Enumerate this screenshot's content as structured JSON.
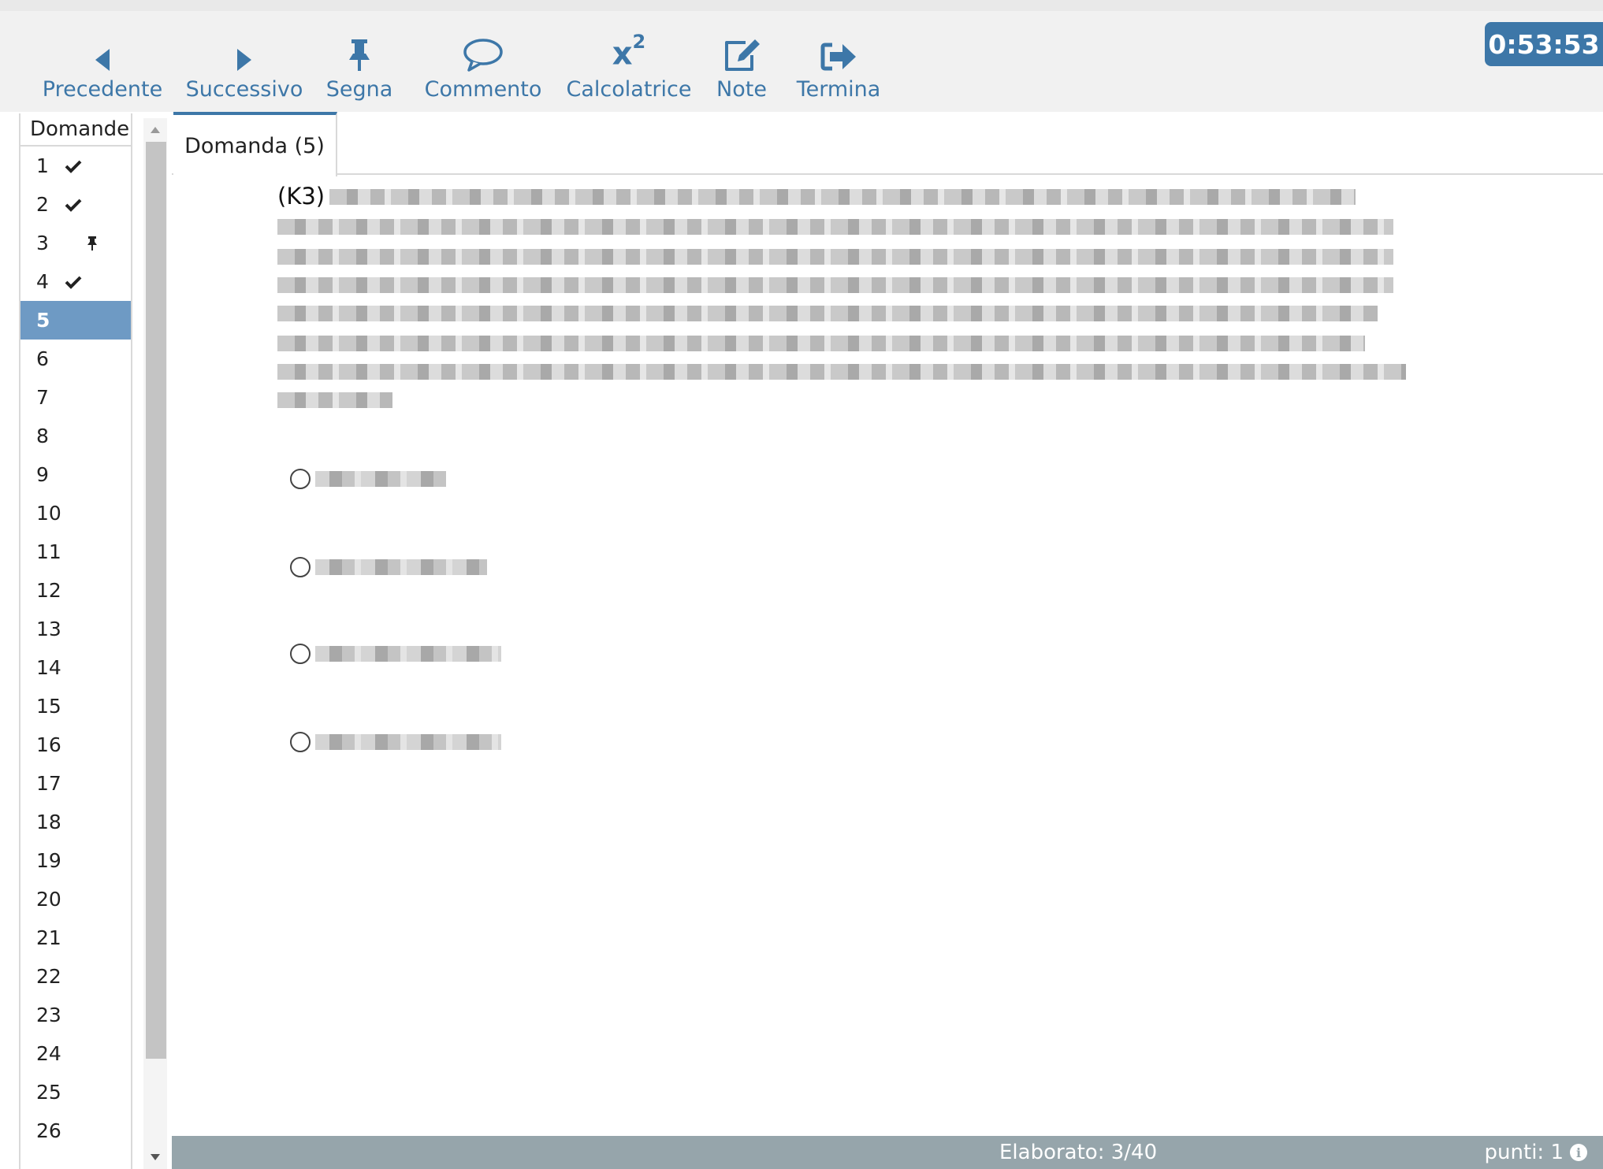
{
  "toolbar": {
    "buttons": [
      {
        "label": "Precedente",
        "icon": "triangle-left-icon"
      },
      {
        "label": "Successivo",
        "icon": "triangle-right-icon"
      },
      {
        "label": "Segna",
        "icon": "pin-icon"
      },
      {
        "label": "Commento",
        "icon": "comment-icon"
      },
      {
        "label": "Calcolatrice",
        "icon": "superscript-icon"
      },
      {
        "label": "Note",
        "icon": "edit-icon"
      },
      {
        "label": "Termina",
        "icon": "sign-out-icon"
      }
    ],
    "timer": "0:53:53",
    "accent_color": "#3d77a8"
  },
  "sidebar": {
    "header": "Domande",
    "items": [
      {
        "label": "1",
        "status": "answered"
      },
      {
        "label": "2",
        "status": "answered"
      },
      {
        "label": "3",
        "status": "marked"
      },
      {
        "label": "4",
        "status": "answered"
      },
      {
        "label": "5",
        "status": "current"
      },
      {
        "label": "6"
      },
      {
        "label": "7"
      },
      {
        "label": "8"
      },
      {
        "label": "9"
      },
      {
        "label": "10"
      },
      {
        "label": "11"
      },
      {
        "label": "12"
      },
      {
        "label": "13"
      },
      {
        "label": "14"
      },
      {
        "label": "15"
      },
      {
        "label": "16"
      },
      {
        "label": "17"
      },
      {
        "label": "18"
      },
      {
        "label": "19"
      },
      {
        "label": "20"
      },
      {
        "label": "21"
      },
      {
        "label": "22"
      },
      {
        "label": "23"
      },
      {
        "label": "24"
      },
      {
        "label": "25"
      },
      {
        "label": "26"
      }
    ]
  },
  "main": {
    "tab_label": "Domanda (5)",
    "question_prefix": "(K3)",
    "options_count": 4
  },
  "footer": {
    "progress": "Elaborato: 3/40",
    "points": "punti: 1",
    "bar_color": "#96a5ab"
  }
}
